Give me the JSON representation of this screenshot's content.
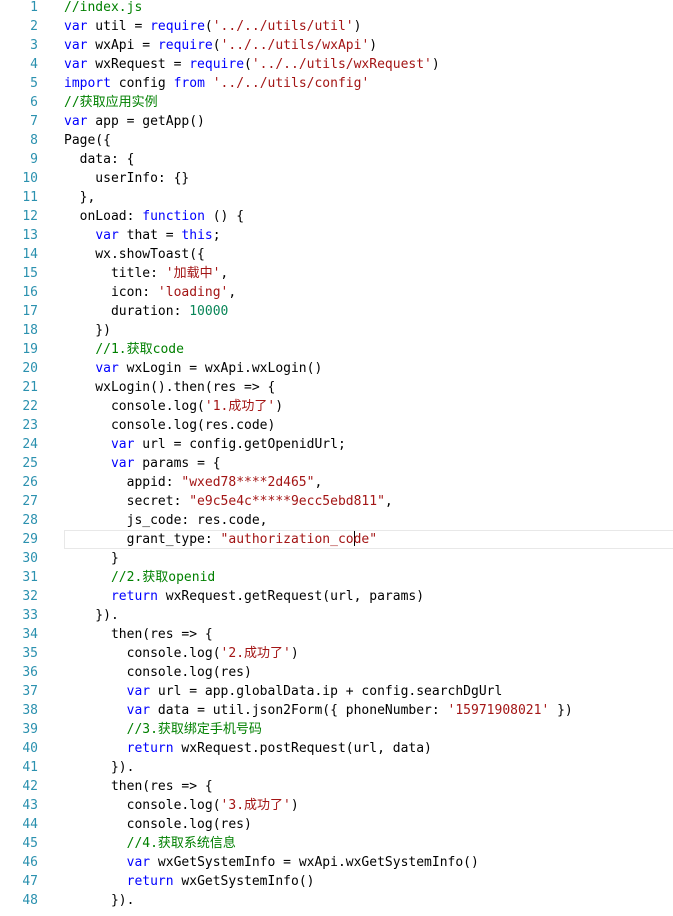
{
  "editor": {
    "colors": {
      "keyword": "#0000ff",
      "string": "#a31515",
      "comment": "#008000",
      "number": "#098658",
      "line_number": "#2b91af",
      "plain": "#000000"
    },
    "current_line": 29,
    "lines": [
      {
        "n": "1",
        "tokens": [
          [
            "com",
            "//index.js"
          ]
        ]
      },
      {
        "n": "2",
        "tokens": [
          [
            "kw",
            "var"
          ],
          [
            "pl",
            " util = "
          ],
          [
            "kw",
            "require"
          ],
          [
            "pl",
            "("
          ],
          [
            "str",
            "'../../utils/util'"
          ],
          [
            "pl",
            ")"
          ]
        ]
      },
      {
        "n": "3",
        "tokens": [
          [
            "kw",
            "var"
          ],
          [
            "pl",
            " wxApi = "
          ],
          [
            "kw",
            "require"
          ],
          [
            "pl",
            "("
          ],
          [
            "str",
            "'../../utils/wxApi'"
          ],
          [
            "pl",
            ")"
          ]
        ]
      },
      {
        "n": "4",
        "tokens": [
          [
            "kw",
            "var"
          ],
          [
            "pl",
            " wxRequest = "
          ],
          [
            "kw",
            "require"
          ],
          [
            "pl",
            "("
          ],
          [
            "str",
            "'../../utils/wxRequest'"
          ],
          [
            "pl",
            ")"
          ]
        ]
      },
      {
        "n": "5",
        "tokens": [
          [
            "kw",
            "import"
          ],
          [
            "pl",
            " config "
          ],
          [
            "kw",
            "from"
          ],
          [
            "pl",
            " "
          ],
          [
            "str",
            "'../../utils/config'"
          ]
        ]
      },
      {
        "n": "6",
        "tokens": [
          [
            "com",
            "//获取应用实例"
          ]
        ]
      },
      {
        "n": "7",
        "tokens": [
          [
            "kw",
            "var"
          ],
          [
            "pl",
            " app = getApp()"
          ]
        ]
      },
      {
        "n": "8",
        "tokens": [
          [
            "pl",
            "Page({"
          ]
        ]
      },
      {
        "n": "9",
        "tokens": [
          [
            "pl",
            "  data: {"
          ]
        ]
      },
      {
        "n": "10",
        "tokens": [
          [
            "pl",
            "    userInfo: {}"
          ]
        ]
      },
      {
        "n": "11",
        "tokens": [
          [
            "pl",
            "  },"
          ]
        ]
      },
      {
        "n": "12",
        "tokens": [
          [
            "pl",
            "  onLoad: "
          ],
          [
            "kw",
            "function"
          ],
          [
            "pl",
            " () {"
          ]
        ]
      },
      {
        "n": "13",
        "tokens": [
          [
            "pl",
            "    "
          ],
          [
            "kw",
            "var"
          ],
          [
            "pl",
            " that = "
          ],
          [
            "kw",
            "this"
          ],
          [
            "pl",
            ";"
          ]
        ]
      },
      {
        "n": "14",
        "tokens": [
          [
            "pl",
            "    wx.showToast({"
          ]
        ]
      },
      {
        "n": "15",
        "tokens": [
          [
            "pl",
            "      title: "
          ],
          [
            "str",
            "'加载中'"
          ],
          [
            "pl",
            ","
          ]
        ]
      },
      {
        "n": "16",
        "tokens": [
          [
            "pl",
            "      icon: "
          ],
          [
            "str",
            "'loading'"
          ],
          [
            "pl",
            ","
          ]
        ]
      },
      {
        "n": "17",
        "tokens": [
          [
            "pl",
            "      duration: "
          ],
          [
            "num",
            "10000"
          ]
        ]
      },
      {
        "n": "18",
        "tokens": [
          [
            "pl",
            "    })"
          ]
        ]
      },
      {
        "n": "19",
        "tokens": [
          [
            "pl",
            "    "
          ],
          [
            "com",
            "//1.获取code"
          ]
        ]
      },
      {
        "n": "20",
        "tokens": [
          [
            "pl",
            "    "
          ],
          [
            "kw",
            "var"
          ],
          [
            "pl",
            " wxLogin = wxApi.wxLogin()"
          ]
        ]
      },
      {
        "n": "21",
        "tokens": [
          [
            "pl",
            "    wxLogin().then(res => {"
          ]
        ]
      },
      {
        "n": "22",
        "tokens": [
          [
            "pl",
            "      console.log("
          ],
          [
            "str",
            "'1.成功了'"
          ],
          [
            "pl",
            ")"
          ]
        ]
      },
      {
        "n": "23",
        "tokens": [
          [
            "pl",
            "      console.log(res.code)"
          ]
        ]
      },
      {
        "n": "24",
        "tokens": [
          [
            "pl",
            "      "
          ],
          [
            "kw",
            "var"
          ],
          [
            "pl",
            " url = config.getOpenidUrl;"
          ]
        ]
      },
      {
        "n": "25",
        "tokens": [
          [
            "pl",
            "      "
          ],
          [
            "kw",
            "var"
          ],
          [
            "pl",
            " params = {"
          ]
        ]
      },
      {
        "n": "26",
        "tokens": [
          [
            "pl",
            "        appid: "
          ],
          [
            "str",
            "\"wxed78****2d465\""
          ],
          [
            "pl",
            ","
          ]
        ]
      },
      {
        "n": "27",
        "tokens": [
          [
            "pl",
            "        secret: "
          ],
          [
            "str",
            "\"e9c5e4c*****9ecc5ebd811\""
          ],
          [
            "pl",
            ","
          ]
        ]
      },
      {
        "n": "28",
        "tokens": [
          [
            "pl",
            "        js_code: res.code,"
          ]
        ]
      },
      {
        "n": "29",
        "tokens": [
          [
            "pl",
            "        grant_type: "
          ],
          [
            "str",
            "\"authorization_co"
          ],
          [
            "cursor",
            ""
          ],
          [
            "str",
            "de\""
          ]
        ]
      },
      {
        "n": "30",
        "tokens": [
          [
            "pl",
            "      }"
          ]
        ]
      },
      {
        "n": "31",
        "tokens": [
          [
            "pl",
            "      "
          ],
          [
            "com",
            "//2.获取openid"
          ]
        ]
      },
      {
        "n": "32",
        "tokens": [
          [
            "pl",
            "      "
          ],
          [
            "kw",
            "return"
          ],
          [
            "pl",
            " wxRequest.getRequest(url, params)"
          ]
        ]
      },
      {
        "n": "33",
        "tokens": [
          [
            "pl",
            "    })."
          ]
        ]
      },
      {
        "n": "34",
        "tokens": [
          [
            "pl",
            "      then(res => {"
          ]
        ]
      },
      {
        "n": "35",
        "tokens": [
          [
            "pl",
            "        console.log("
          ],
          [
            "str",
            "'2.成功了'"
          ],
          [
            "pl",
            ")"
          ]
        ]
      },
      {
        "n": "36",
        "tokens": [
          [
            "pl",
            "        console.log(res)"
          ]
        ]
      },
      {
        "n": "37",
        "tokens": [
          [
            "pl",
            "        "
          ],
          [
            "kw",
            "var"
          ],
          [
            "pl",
            " url = app.globalData.ip + config.searchDgUrl"
          ]
        ]
      },
      {
        "n": "38",
        "tokens": [
          [
            "pl",
            "        "
          ],
          [
            "kw",
            "var"
          ],
          [
            "pl",
            " data = util.json2Form({ phoneNumber: "
          ],
          [
            "str",
            "'15971908021'"
          ],
          [
            "pl",
            " })"
          ]
        ]
      },
      {
        "n": "39",
        "tokens": [
          [
            "pl",
            "        "
          ],
          [
            "com",
            "//3.获取绑定手机号码"
          ]
        ]
      },
      {
        "n": "40",
        "tokens": [
          [
            "pl",
            "        "
          ],
          [
            "kw",
            "return"
          ],
          [
            "pl",
            " wxRequest.postRequest(url, data)"
          ]
        ]
      },
      {
        "n": "41",
        "tokens": [
          [
            "pl",
            "      })."
          ]
        ]
      },
      {
        "n": "42",
        "tokens": [
          [
            "pl",
            "      then(res => {"
          ]
        ]
      },
      {
        "n": "43",
        "tokens": [
          [
            "pl",
            "        console.log("
          ],
          [
            "str",
            "'3.成功了'"
          ],
          [
            "pl",
            ")"
          ]
        ]
      },
      {
        "n": "44",
        "tokens": [
          [
            "pl",
            "        console.log(res)"
          ]
        ]
      },
      {
        "n": "45",
        "tokens": [
          [
            "pl",
            "        "
          ],
          [
            "com",
            "//4.获取系统信息"
          ]
        ]
      },
      {
        "n": "46",
        "tokens": [
          [
            "pl",
            "        "
          ],
          [
            "kw",
            "var"
          ],
          [
            "pl",
            " wxGetSystemInfo = wxApi.wxGetSystemInfo()"
          ]
        ]
      },
      {
        "n": "47",
        "tokens": [
          [
            "pl",
            "        "
          ],
          [
            "kw",
            "return"
          ],
          [
            "pl",
            " wxGetSystemInfo()"
          ]
        ]
      },
      {
        "n": "48",
        "tokens": [
          [
            "pl",
            "      })."
          ]
        ]
      }
    ]
  }
}
